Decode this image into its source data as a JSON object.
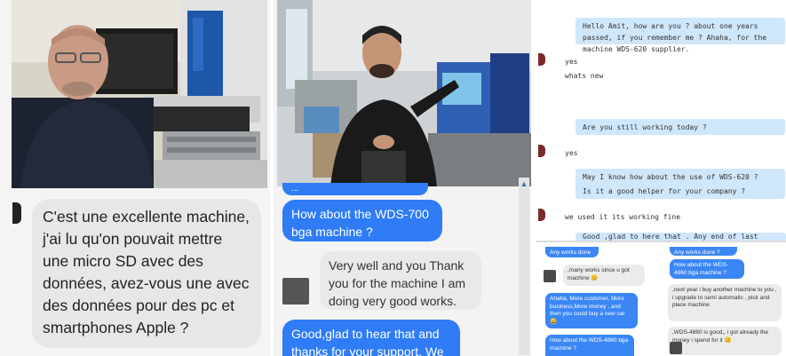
{
  "panel1": {
    "message": "C'est une excellente machine, j'ai lu qu'on pouvait mettre une micro SD avec des données, avez-vous une avec des données pour des pc et smartphones Apple ?"
  },
  "panel2": {
    "partial_top": "...",
    "msg1": "How about the WDS-700 bga machine ?",
    "msg2": "Very well and you Thank you for the machine I am doing very good works.",
    "msg3": "Good,glad to hear that and thanks for your support. We"
  },
  "panel3": {
    "top": [
      {
        "side": "out",
        "text": "Hello Amit, how are you ? about one years passed, if you remember me ? Ahaha, for the machine WDS-620 supplier."
      },
      {
        "side": "in",
        "text": "yes"
      },
      {
        "side": "in",
        "text": "whats new"
      },
      {
        "side": "out",
        "text": "Are you still working today ?"
      },
      {
        "side": "in",
        "text": "yes"
      },
      {
        "side": "out",
        "text": "May I know how about the use of WDS-620 ?"
      },
      {
        "side": "out",
        "text": "Is it a good helper for your company ?"
      },
      {
        "side": "in",
        "text": "we used it its working fine"
      },
      {
        "side": "out",
        "text": "Good ,glad to here that . Any end of last year, we have"
      }
    ],
    "bottom_left": [
      {
        "side": "out",
        "text": "Any works done ?"
      },
      {
        "side": "in",
        "text": ",many works since u got machine 😊"
      },
      {
        "side": "out",
        "text": "Ahaha, More customer, More business,More money , and then you could buy a new car 😀"
      },
      {
        "side": "out",
        "text": "How about the WDS-4860 bga machine ?"
      }
    ],
    "bottom_right": [
      {
        "side": "out",
        "text": "Any works done ?"
      },
      {
        "side": "out",
        "text": "How about the WDS-4860 bga machine ?"
      },
      {
        "side": "in",
        "text": ",next year i buy another machine to you , i upgrade to semi automatic , pick and place machine"
      },
      {
        "side": "in",
        "text": ",WDS-4860 is good,, i got already the money i spend for it 😊"
      }
    ]
  }
}
